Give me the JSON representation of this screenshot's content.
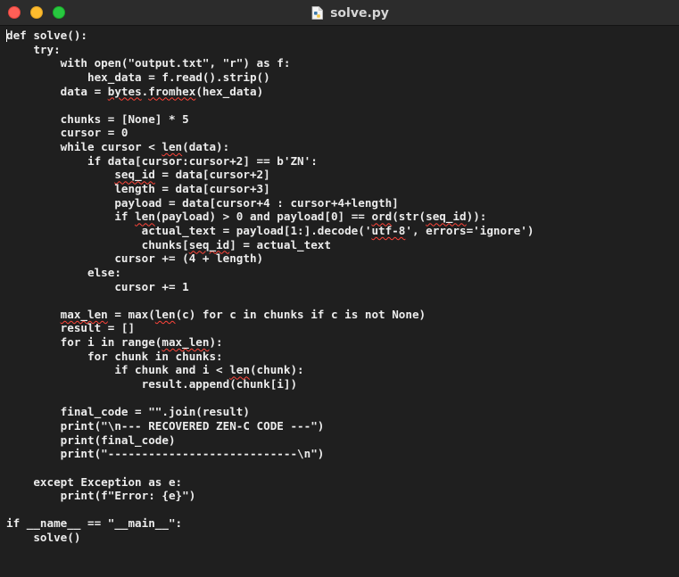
{
  "window": {
    "title": "solve.py",
    "file_icon": "python-file-icon"
  },
  "editor": {
    "lines": [
      [
        {
          "t": "def solve():"
        }
      ],
      [
        {
          "t": "    try:"
        }
      ],
      [
        {
          "t": "        with open(\"output.txt\", \"r\") as f:"
        }
      ],
      [
        {
          "t": "            hex_data = f.read().strip()"
        }
      ],
      [
        {
          "t": "        data = "
        },
        {
          "t": "bytes",
          "s": 1
        },
        {
          "t": "."
        },
        {
          "t": "fromhex",
          "s": 1
        },
        {
          "t": "(hex_data)"
        }
      ],
      [
        {
          "t": ""
        }
      ],
      [
        {
          "t": "        chunks = [None] * 5"
        }
      ],
      [
        {
          "t": "        cursor = 0"
        }
      ],
      [
        {
          "t": "        while cursor < "
        },
        {
          "t": "len",
          "s": 1
        },
        {
          "t": "(data):"
        }
      ],
      [
        {
          "t": "            if data[cursor:cursor+2] == b'ZN':"
        }
      ],
      [
        {
          "t": "                "
        },
        {
          "t": "seq_id",
          "s": 1
        },
        {
          "t": " = data[cursor+2]"
        }
      ],
      [
        {
          "t": "                length = data[cursor+3]"
        }
      ],
      [
        {
          "t": "                payload = data[cursor+4 : cursor+4+length]"
        }
      ],
      [
        {
          "t": "                if "
        },
        {
          "t": "len",
          "s": 1
        },
        {
          "t": "(payload) > 0 and payload[0] == "
        },
        {
          "t": "ord",
          "s": 1
        },
        {
          "t": "(str("
        },
        {
          "t": "seq_id",
          "s": 1
        },
        {
          "t": ")):"
        }
      ],
      [
        {
          "t": "                    actual_text = payload[1:].decode('"
        },
        {
          "t": "utf-8",
          "s": 1
        },
        {
          "t": "', errors='ignore')"
        }
      ],
      [
        {
          "t": "                    chunks["
        },
        {
          "t": "seq_id",
          "s": 1
        },
        {
          "t": "] = actual_text"
        }
      ],
      [
        {
          "t": "                cursor += (4 + length)"
        }
      ],
      [
        {
          "t": "            else:"
        }
      ],
      [
        {
          "t": "                cursor += 1"
        }
      ],
      [
        {
          "t": ""
        }
      ],
      [
        {
          "t": "        "
        },
        {
          "t": "max_len",
          "s": 1
        },
        {
          "t": " = max("
        },
        {
          "t": "len",
          "s": 1
        },
        {
          "t": "(c) for c in chunks if c is not None)"
        }
      ],
      [
        {
          "t": "        result = []"
        }
      ],
      [
        {
          "t": "        for i in range("
        },
        {
          "t": "max_len",
          "s": 1
        },
        {
          "t": "):"
        }
      ],
      [
        {
          "t": "            for chunk in chunks:"
        }
      ],
      [
        {
          "t": "                if chunk and i < "
        },
        {
          "t": "len",
          "s": 1
        },
        {
          "t": "(chunk):"
        }
      ],
      [
        {
          "t": "                    result.append(chunk[i])"
        }
      ],
      [
        {
          "t": ""
        }
      ],
      [
        {
          "t": "        final_code = \"\".join(result)"
        }
      ],
      [
        {
          "t": "        print(\"\\n--- RECOVERED ZEN-C CODE ---\")"
        }
      ],
      [
        {
          "t": "        print(final_code)"
        }
      ],
      [
        {
          "t": "        print(\"----------------------------\\n\")"
        }
      ],
      [
        {
          "t": ""
        }
      ],
      [
        {
          "t": "    except Exception as e:"
        }
      ],
      [
        {
          "t": "        print(f\"Error: {e}\")"
        }
      ],
      [
        {
          "t": ""
        }
      ],
      [
        {
          "t": "if __name__ == \"__main__\":"
        }
      ],
      [
        {
          "t": "    solve()"
        }
      ]
    ]
  }
}
